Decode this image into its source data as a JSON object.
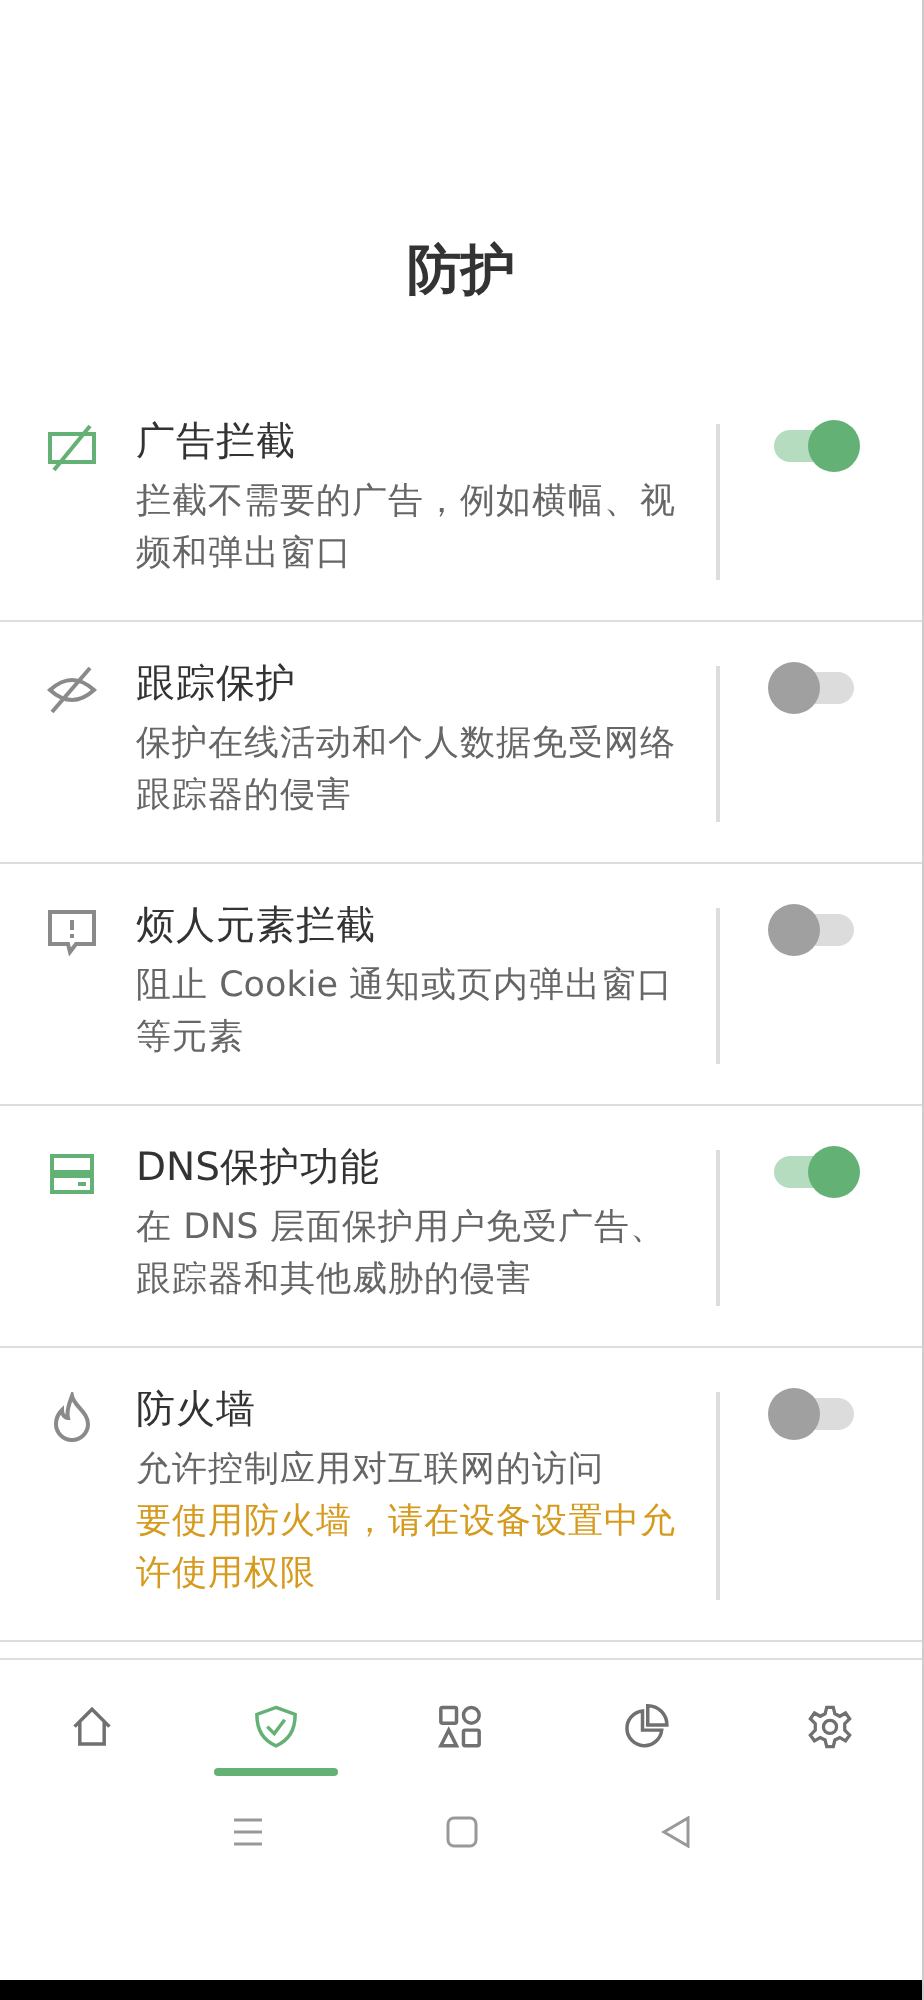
{
  "title": "防护",
  "features": [
    {
      "kind": "ad",
      "title": "广告拦截",
      "description": "拦截不需要的广告，例如横幅、视频和弹出窗口",
      "on": true
    },
    {
      "kind": "eye",
      "title": "跟踪保护",
      "description": "保护在线活动和个人数据免受网络跟踪器的侵害",
      "on": false
    },
    {
      "kind": "alert",
      "title": "烦人元素拦截",
      "description": "阻止 Cookie 通知或页内弹出窗口等元素",
      "on": false
    },
    {
      "kind": "dns",
      "title": "DNS保护功能",
      "description": "在 DNS 层面保护用户免受广告、跟踪器和其他威胁的侵害",
      "on": true
    },
    {
      "kind": "fire",
      "title": "防火墙",
      "description": "允许控制应用对互联网的访问",
      "warning": "要使用防火墙，请在设备设置中允许使用权限",
      "on": false
    }
  ],
  "nav": [
    {
      "kind": "home",
      "selected": false
    },
    {
      "kind": "shield",
      "selected": true
    },
    {
      "kind": "apps",
      "selected": false
    },
    {
      "kind": "stats",
      "selected": false
    },
    {
      "kind": "settings",
      "selected": false
    }
  ],
  "system_nav": [
    {
      "kind": "menu"
    },
    {
      "kind": "home"
    },
    {
      "kind": "back"
    }
  ]
}
